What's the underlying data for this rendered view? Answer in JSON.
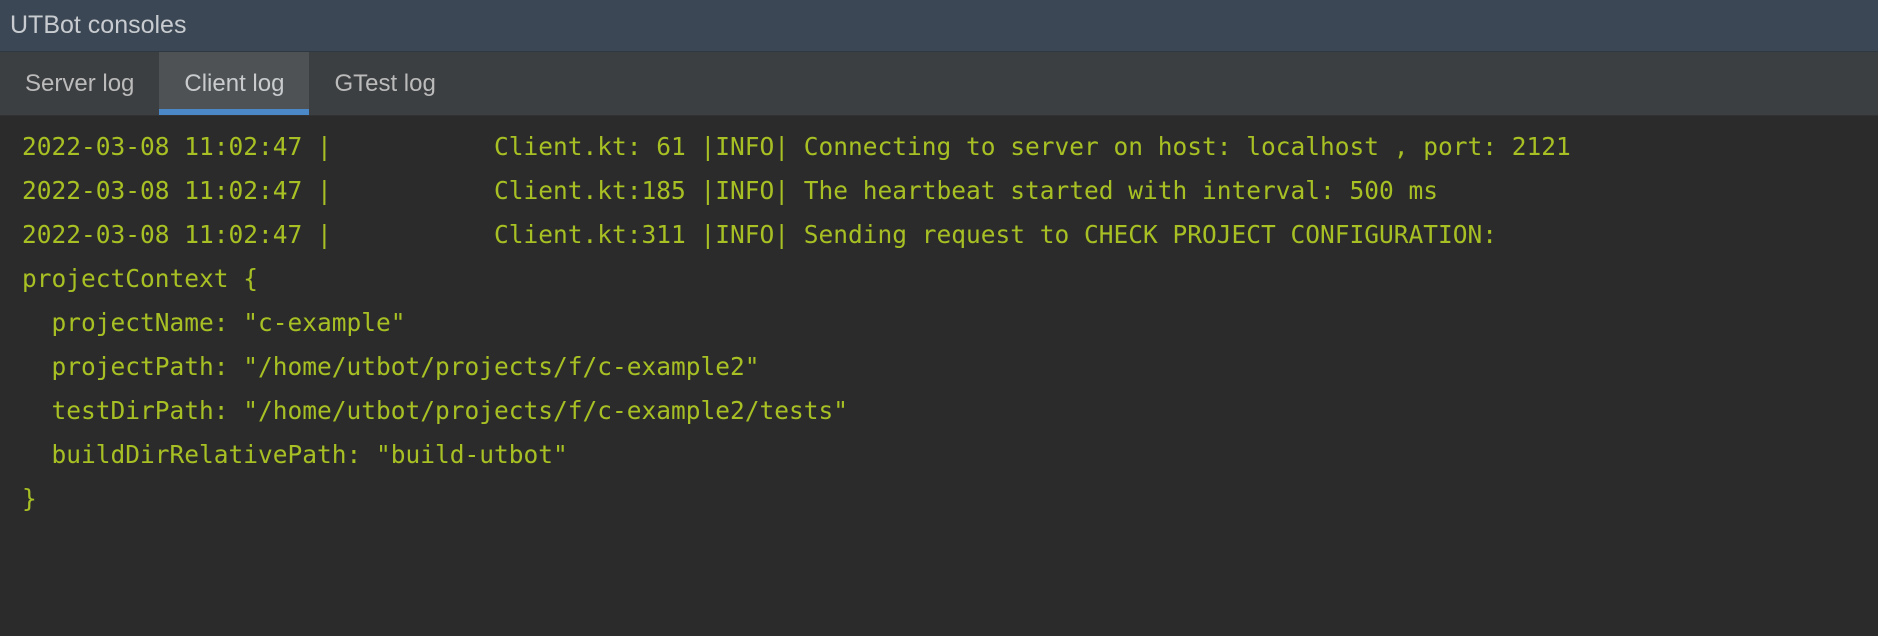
{
  "window": {
    "title": "UTBot consoles"
  },
  "tabs": [
    {
      "label": "Server log",
      "active": false
    },
    {
      "label": "Client log",
      "active": true
    },
    {
      "label": "GTest log",
      "active": false
    }
  ],
  "console": {
    "text_color": "#a8c023",
    "lines": [
      "2022-03-08 11:02:47 |           Client.kt: 61 |INFO| Connecting to server on host: localhost , port: 2121",
      "2022-03-08 11:02:47 |           Client.kt:185 |INFO| The heartbeat started with interval: 500 ms",
      "2022-03-08 11:02:47 |           Client.kt:311 |INFO| Sending request to CHECK PROJECT CONFIGURATION:",
      "projectContext {",
      "  projectName: \"c-example\"",
      "  projectPath: \"/home/utbot/projects/f/c-example2\"",
      "  testDirPath: \"/home/utbot/projects/f/c-example2/tests\"",
      "  buildDirRelativePath: \"build-utbot\"",
      "}"
    ]
  },
  "colors": {
    "titlebar_bg": "#3b4754",
    "tabbar_bg": "#3c3f41",
    "active_tab_bg": "#4e5254",
    "active_tab_underline": "#4a88c7",
    "console_bg": "#2b2b2b"
  }
}
